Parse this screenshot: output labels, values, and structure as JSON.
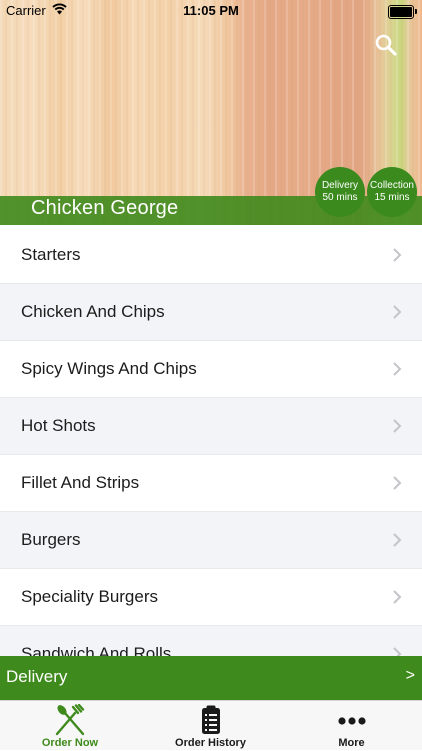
{
  "status_bar": {
    "carrier": "Carrier",
    "time": "11:05 PM"
  },
  "restaurant": {
    "name": "Chicken George"
  },
  "badges": {
    "delivery": {
      "title": "Delivery",
      "time": "50 mins"
    },
    "collection": {
      "title": "Collection",
      "time": "15 mins"
    }
  },
  "menu": {
    "items": [
      {
        "label": "Starters"
      },
      {
        "label": "Chicken And Chips"
      },
      {
        "label": "Spicy Wings And Chips"
      },
      {
        "label": "Hot Shots"
      },
      {
        "label": "Fillet And Strips"
      },
      {
        "label": "Burgers"
      },
      {
        "label": "Speciality Burgers"
      },
      {
        "label": "Sandwich And Rolls"
      }
    ]
  },
  "delivery_bar": {
    "label": "Delivery",
    "arrow": ">"
  },
  "tabs": [
    {
      "label": "Order Now",
      "icon": "fork-knife-icon"
    },
    {
      "label": "Order History",
      "icon": "clipboard-icon"
    },
    {
      "label": "More",
      "icon": "more-dots-icon"
    }
  ],
  "colors": {
    "brand_green": "#3f8a1c",
    "badge_green": "#3b8a1e",
    "row_alt": "#f3f4f7"
  }
}
